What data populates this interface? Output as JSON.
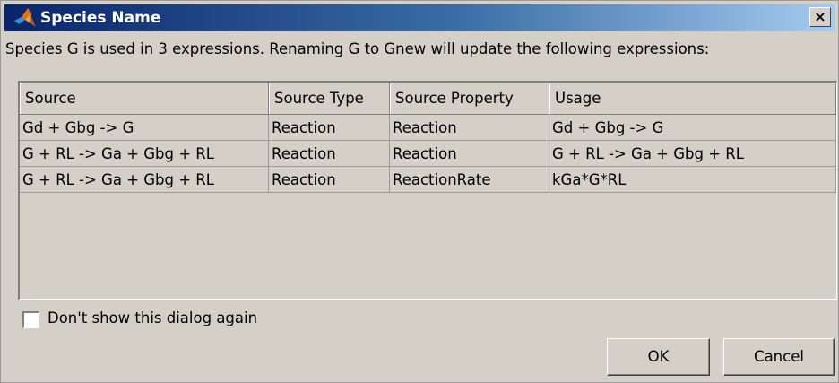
{
  "window": {
    "title": "Species Name",
    "close_label": "×"
  },
  "message": "Species G is used in 3 expressions. Renaming G to Gnew will update the following expressions:",
  "table": {
    "headers": [
      "Source",
      "Source Type",
      "Source Property",
      "Usage"
    ],
    "rows": [
      [
        "Gd + Gbg -> G",
        "Reaction",
        "Reaction",
        "Gd + Gbg -> G"
      ],
      [
        "G + RL -> Ga + Gbg + RL",
        "Reaction",
        "Reaction",
        "G + RL -> Ga + Gbg + RL"
      ],
      [
        "G + RL -> Ga + Gbg + RL",
        "Reaction",
        "ReactionRate",
        "kGa*G*RL"
      ]
    ]
  },
  "checkbox": {
    "label": "Don't show this dialog again",
    "checked": false
  },
  "buttons": {
    "ok": "OK",
    "cancel": "Cancel"
  },
  "icons": {
    "app": "matlab-logo-icon",
    "close": "close-icon"
  },
  "colors": {
    "title_gradient_start": "#0a246a",
    "title_gradient_end": "#a6caf0",
    "dialog_background": "#d4d0c8"
  }
}
